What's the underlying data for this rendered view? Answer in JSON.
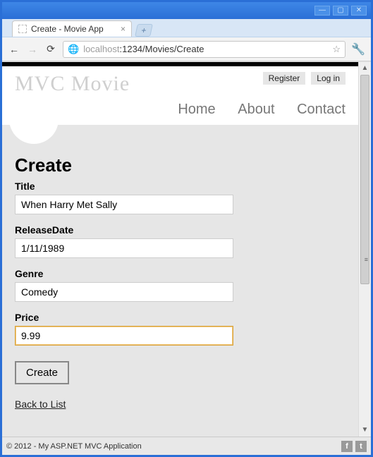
{
  "window": {
    "title": "Create - Movie App"
  },
  "browser": {
    "url_host": "localhost",
    "url_port_path": ":1234/Movies/Create"
  },
  "header": {
    "brand": "MVC Movie",
    "auth": {
      "register": "Register",
      "login": "Log in"
    },
    "nav": {
      "home": "Home",
      "about": "About",
      "contact": "Contact"
    }
  },
  "page": {
    "heading": "Create",
    "fields": {
      "title": {
        "label": "Title",
        "value": "When Harry Met Sally"
      },
      "release_date": {
        "label": "ReleaseDate",
        "value": "1/11/1989"
      },
      "genre": {
        "label": "Genre",
        "value": "Comedy"
      },
      "price": {
        "label": "Price",
        "value": "9.99"
      }
    },
    "submit": "Create",
    "back_link": "Back to List"
  },
  "footer": {
    "copyright": "© 2012 - My ASP.NET MVC Application"
  }
}
